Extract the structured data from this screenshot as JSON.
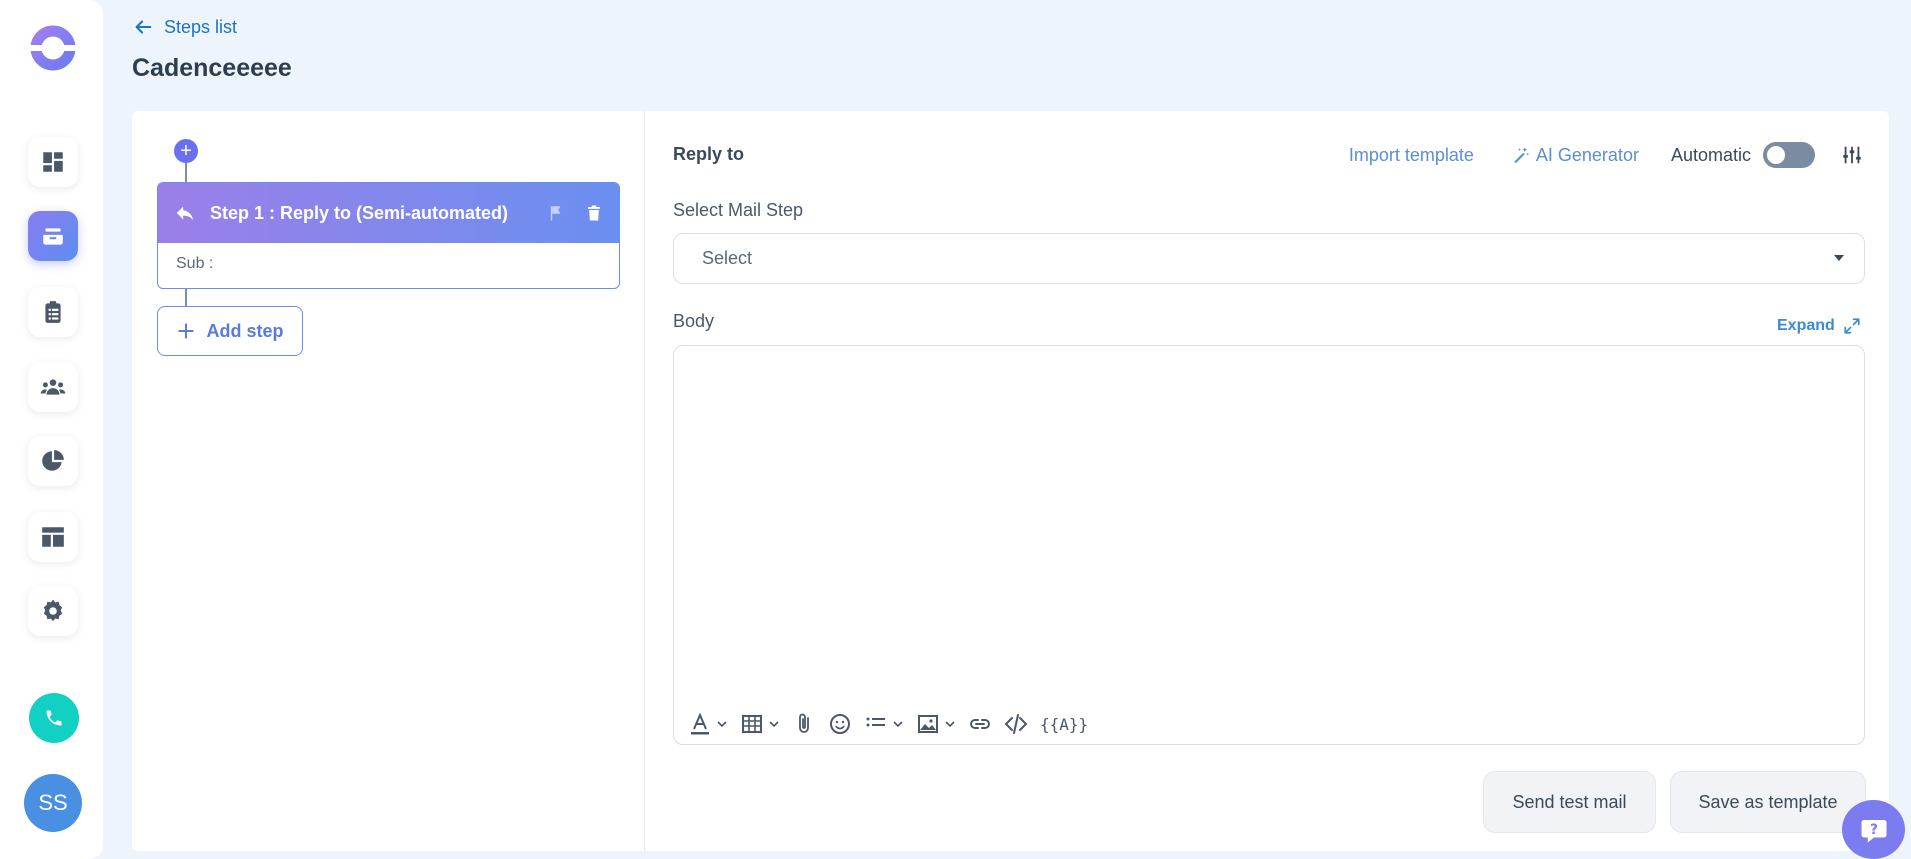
{
  "sidebar": {
    "nav": [
      {
        "icon": "dashboard-icon",
        "name": "nav-dashboard"
      },
      {
        "icon": "inbox-stack-icon",
        "name": "nav-cadences",
        "active": true
      },
      {
        "icon": "clipboard-list-icon",
        "name": "nav-tasks"
      },
      {
        "icon": "people-icon",
        "name": "nav-contacts"
      },
      {
        "icon": "pie-chart-icon",
        "name": "nav-reports"
      },
      {
        "icon": "layout-icon",
        "name": "nav-templates"
      },
      {
        "icon": "gear-icon",
        "name": "nav-settings"
      }
    ],
    "avatar_initials": "SS"
  },
  "header": {
    "back_label": "Steps list",
    "title": "Cadenceeeee"
  },
  "steps": {
    "step_title": "Step 1 : Reply to (Semi-automated)",
    "step_sub": "Sub :",
    "add_step_label": "Add step"
  },
  "editor": {
    "title": "Reply to",
    "import_template": "Import template",
    "ai_generator": "AI Generator",
    "automatic_label": "Automatic",
    "automatic_on": false,
    "select_mail_step_label": "Select Mail Step",
    "select_value": "Select",
    "body_label": "Body",
    "expand_label": "Expand",
    "variables_label": "{{A}}"
  },
  "footer": {
    "send_test_mail": "Send test mail",
    "save_as_template": "Save as template"
  },
  "colors": {
    "accent": "#6a8ef0",
    "brand_purple": "#9b7fe8",
    "call_green": "#12d0c4",
    "link_blue": "#1a73c9"
  }
}
